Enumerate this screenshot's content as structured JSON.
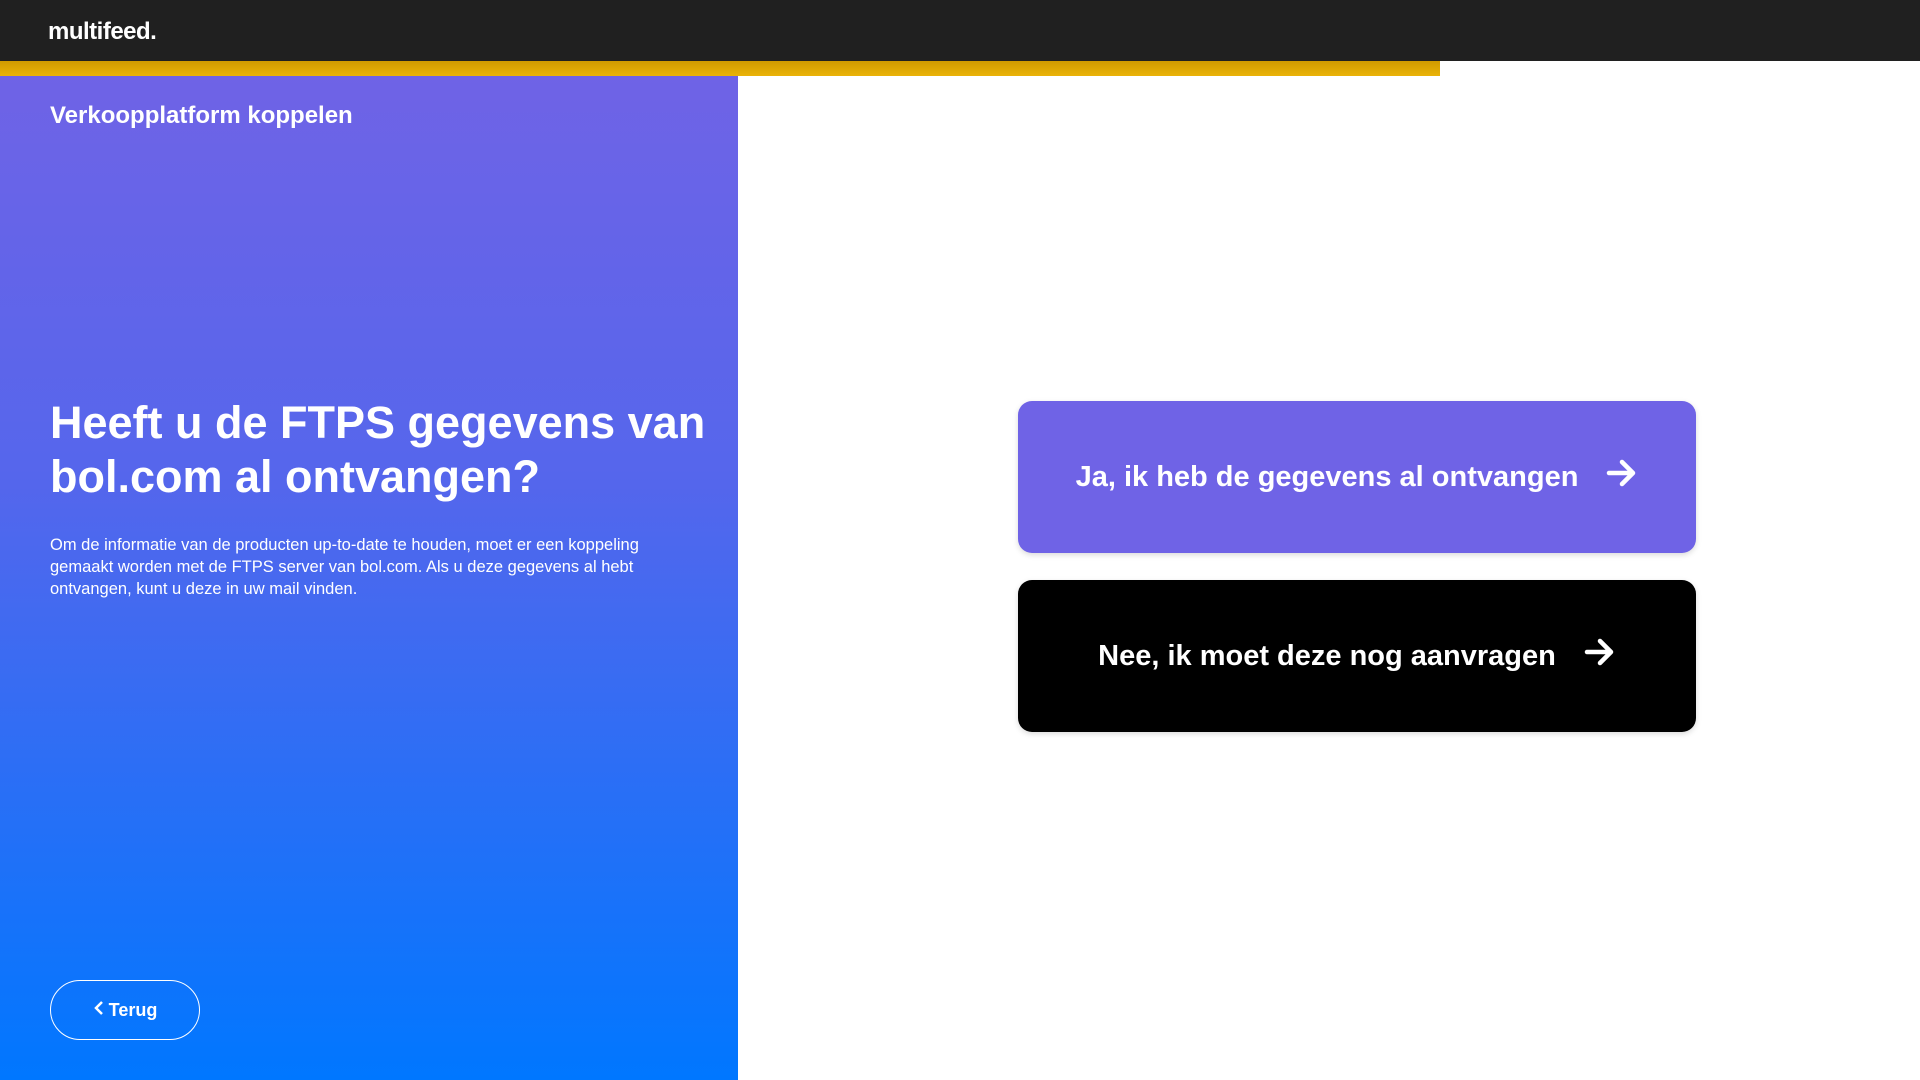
{
  "header": {
    "logo": "multifeed."
  },
  "progress": {
    "percent": 75
  },
  "left": {
    "breadcrumb": "Verkoopplatform koppelen",
    "heading": "Heeft u de FTPS gegevens van bol.com al ontvangen?",
    "paragraph": "Om de informatie van de producten up-to-date te houden, moet er een koppeling gemaakt worden met de FTPS server van bol.com. Als u deze gegevens al hebt ontvangen, kunt u deze in uw mail vinden.",
    "back_label": "Terug"
  },
  "options": {
    "yes_label": "Ja, ik heb de gegevens al ontvangen",
    "no_label": "Nee, ik moet deze nog aanvragen"
  }
}
